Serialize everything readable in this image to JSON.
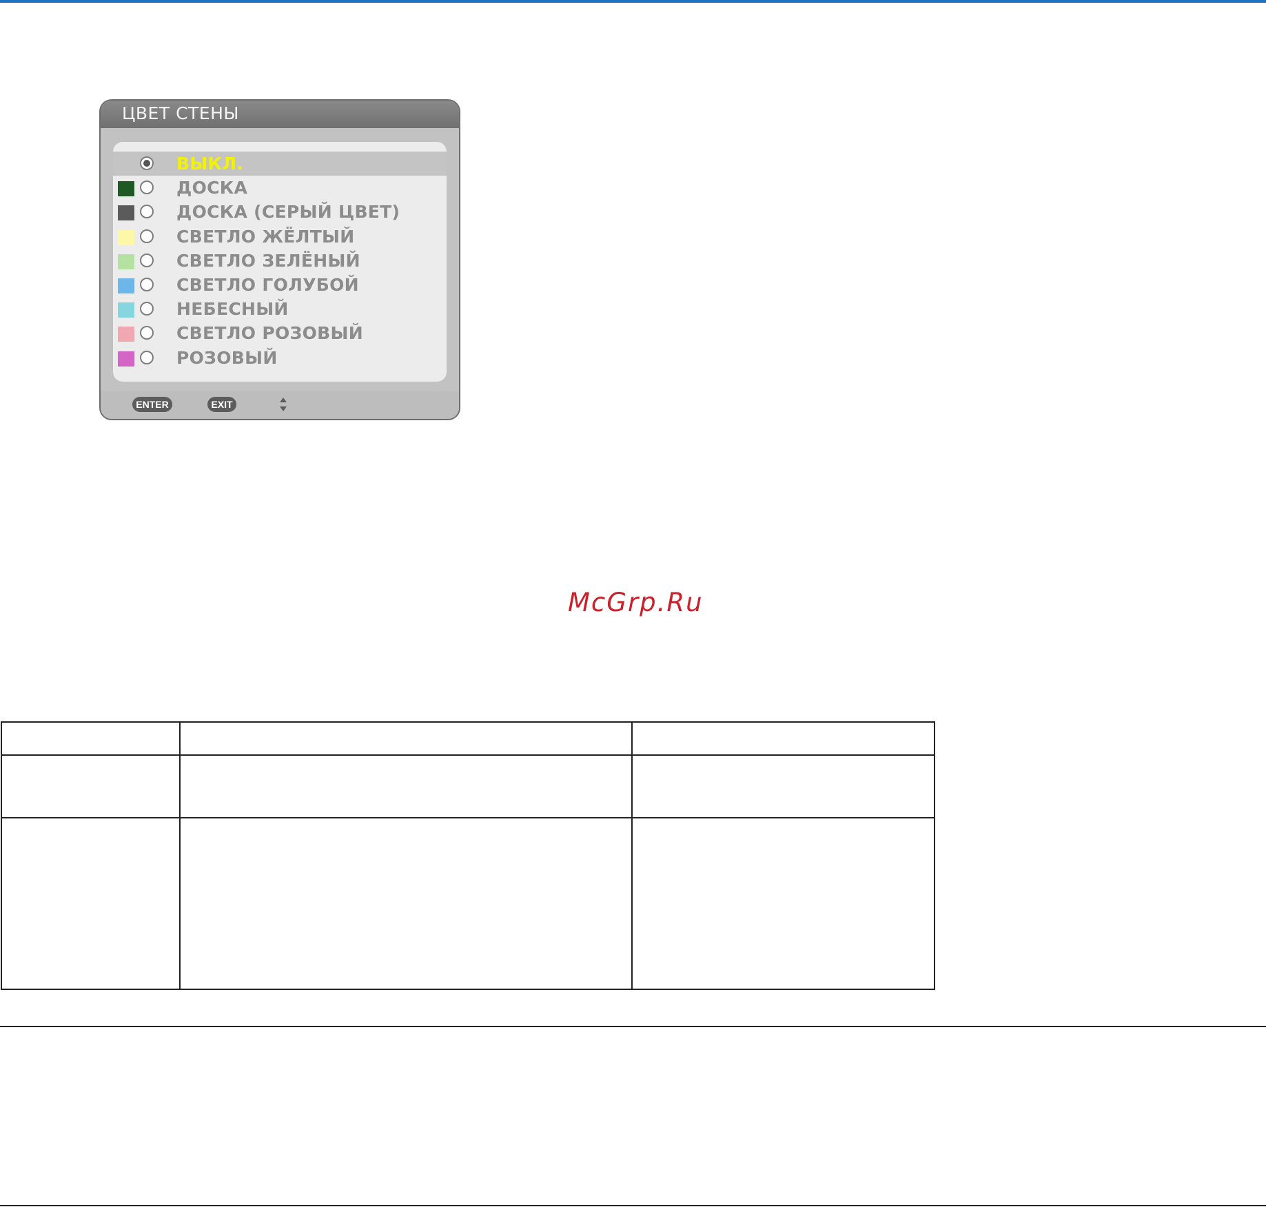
{
  "osd": {
    "title": "ЦВЕТ СТЕНЫ",
    "items": [
      {
        "label": "ВЫКЛ.",
        "swatch": "",
        "selected": true
      },
      {
        "label": "ДОСКА",
        "swatch": "#1f5a25",
        "selected": false
      },
      {
        "label": "ДОСКА (СЕРЫЙ ЦВЕТ)",
        "swatch": "#5b5b5b",
        "selected": false
      },
      {
        "label": "СВЕТЛО ЖЁЛТЫЙ",
        "swatch": "#fdf7a8",
        "selected": false
      },
      {
        "label": "СВЕТЛО ЗЕЛЁНЫЙ",
        "swatch": "#b5e2a3",
        "selected": false
      },
      {
        "label": "СВЕТЛО ГОЛУБОЙ",
        "swatch": "#6fb6e8",
        "selected": false
      },
      {
        "label": "НЕБЕСНЫЙ",
        "swatch": "#86d6df",
        "selected": false
      },
      {
        "label": "СВЕТЛО РОЗОВЫЙ",
        "swatch": "#f2a8b1",
        "selected": false
      },
      {
        "label": "РОЗОВЫЙ",
        "swatch": "#d366c4",
        "selected": false
      }
    ],
    "footer": {
      "enter_label": "ENTER",
      "exit_label": "EXIT"
    }
  },
  "watermark": "McGrp.Ru",
  "colors": {
    "accent_rule": "#1e74c0",
    "selected_text": "#f1f10d",
    "watermark": "#c8232c"
  }
}
